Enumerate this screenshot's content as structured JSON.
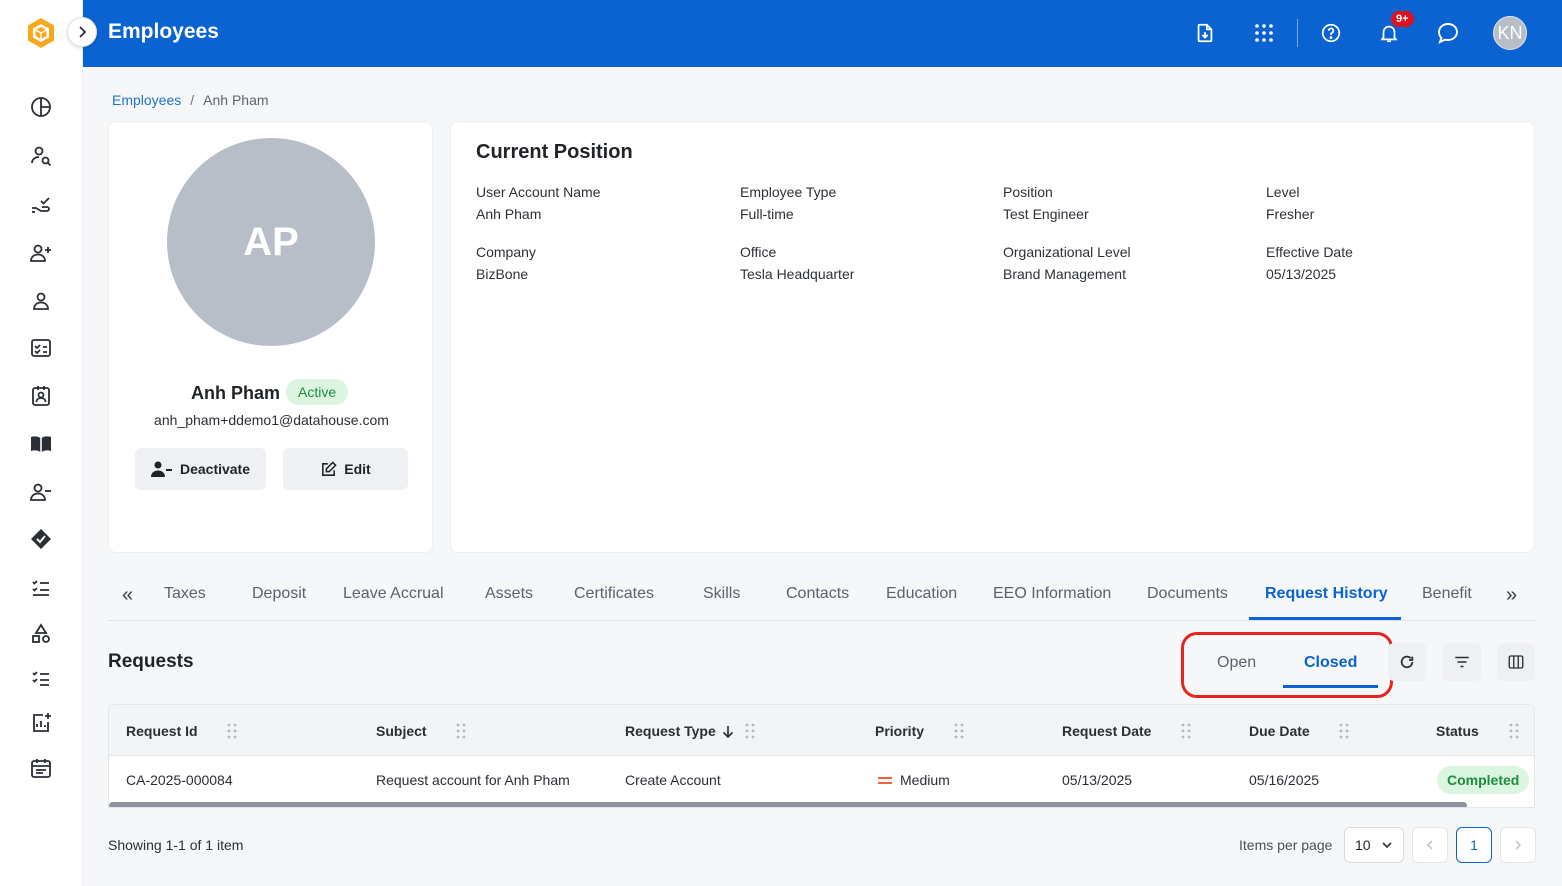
{
  "app": {
    "title": "Employees",
    "notification_badge": "9+",
    "user_initials": "KN",
    "brand_color": "#0a63d1"
  },
  "breadcrumb": {
    "parent": "Employees",
    "separator": "/",
    "current": "Anh Pham"
  },
  "profile": {
    "initials": "AP",
    "name": "Anh Pham",
    "status": "Active",
    "email": "anh_pham+ddemo1@datahouse.com",
    "deactivate_label": "Deactivate",
    "edit_label": "Edit"
  },
  "position": {
    "title": "Current Position",
    "fields": [
      {
        "label": "User Account Name",
        "value": "Anh Pham"
      },
      {
        "label": "Employee Type",
        "value": "Full-time"
      },
      {
        "label": "Position",
        "value": "Test Engineer"
      },
      {
        "label": "Level",
        "value": "Fresher"
      },
      {
        "label": "Company",
        "value": "BizBone"
      },
      {
        "label": "Office",
        "value": "Tesla Headquarter"
      },
      {
        "label": "Organizational Level",
        "value": "Brand Management"
      },
      {
        "label": "Effective Date",
        "value": "05/13/2025"
      }
    ]
  },
  "tabs": [
    "Taxes",
    "Deposit",
    "Leave Accrual",
    "Assets",
    "Certificates",
    "Skills",
    "Contacts",
    "Education",
    "EEO Information",
    "Documents",
    "Request History",
    "Benefit"
  ],
  "active_tab": "Request History",
  "requests": {
    "title": "Requests",
    "toggle": {
      "open": "Open",
      "closed": "Closed",
      "selected": "Closed"
    },
    "columns": [
      "Request Id",
      "Subject",
      "Request Type",
      "Priority",
      "Request Date",
      "Due Date",
      "Status"
    ],
    "rows": [
      {
        "id": "CA-2025-000084",
        "subject": "Request account for Anh Pham",
        "type": "Create Account",
        "priority": "Medium",
        "request_date": "05/13/2025",
        "due_date": "05/16/2025",
        "status": "Completed"
      }
    ]
  },
  "pagination": {
    "showing": "Showing 1-1 of 1 item",
    "items_per_page_label": "Items per page",
    "items_per_page": "10",
    "current_page": "1"
  }
}
